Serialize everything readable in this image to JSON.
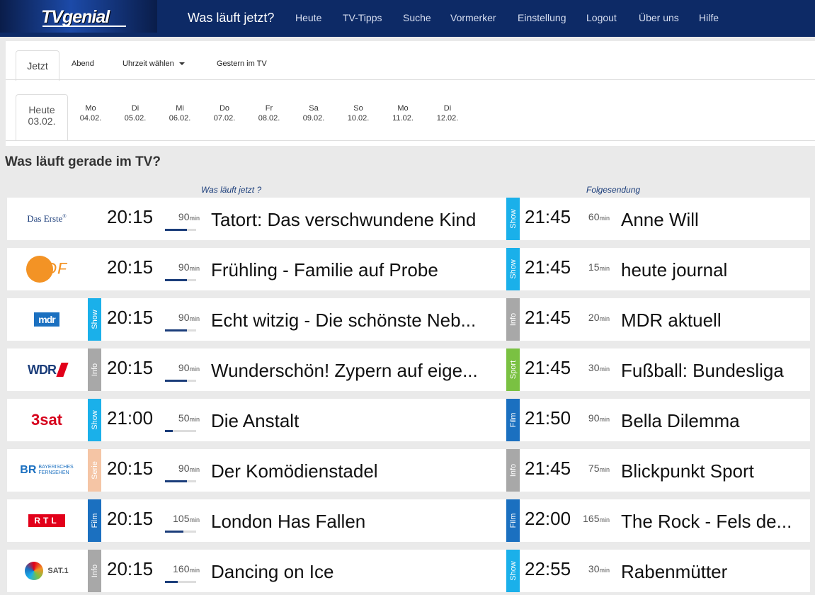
{
  "nav": {
    "logo": "TVgenial",
    "active": "Was läuft jetzt?",
    "items": [
      "Heute",
      "TV-Tipps",
      "Suche",
      "Vormerker",
      "Einstellung",
      "Logout",
      "Über uns",
      "Hilfe"
    ]
  },
  "tabs": {
    "active": "Jetzt",
    "items": [
      "Abend",
      "Uhrzeit wählen",
      "Gestern im TV"
    ]
  },
  "days": {
    "active": {
      "label": "Heute",
      "date": "03.02."
    },
    "items": [
      {
        "day": "Mo",
        "date": "04.02."
      },
      {
        "day": "Di",
        "date": "05.02."
      },
      {
        "day": "Mi",
        "date": "06.02."
      },
      {
        "day": "Do",
        "date": "07.02."
      },
      {
        "day": "Fr",
        "date": "08.02."
      },
      {
        "day": "Sa",
        "date": "09.02."
      },
      {
        "day": "So",
        "date": "10.02."
      },
      {
        "day": "Mo",
        "date": "11.02."
      },
      {
        "day": "Di",
        "date": "12.02."
      }
    ]
  },
  "heading": "Was läuft gerade im TV?",
  "column_now": "Was läuft jetzt ?",
  "column_next": "Folgesendung",
  "unit": "min",
  "genre_colors": {
    "Show": "#1ab0ea",
    "Info": "#a8a8a8",
    "Sport": "#7ac142",
    "Film": "#1b70c0",
    "Serie": "#f5c5a5"
  },
  "rows": [
    {
      "channel": "Das Erste",
      "genre": "",
      "time": "20:15",
      "dur": "90",
      "progress": 0.7,
      "title": "Tatort: Das verschwundene Kind",
      "next_genre": "Show",
      "next_time": "21:45",
      "next_dur": "60",
      "next_title": "Anne Will"
    },
    {
      "channel": "ZDF",
      "genre": "",
      "time": "20:15",
      "dur": "90",
      "progress": 0.7,
      "title": "Frühling - Familie auf Probe",
      "next_genre": "Show",
      "next_time": "21:45",
      "next_dur": "15",
      "next_title": "heute journal"
    },
    {
      "channel": "mdr",
      "genre": "Show",
      "time": "20:15",
      "dur": "90",
      "progress": 0.7,
      "title": "Echt witzig - Die schönste Neb...",
      "next_genre": "Info",
      "next_time": "21:45",
      "next_dur": "20",
      "next_title": "MDR aktuell"
    },
    {
      "channel": "WDR",
      "genre": "Info",
      "time": "20:15",
      "dur": "90",
      "progress": 0.7,
      "title": "Wunderschön! Zypern auf eige...",
      "next_genre": "Sport",
      "next_time": "21:45",
      "next_dur": "30",
      "next_title": "Fußball: Bundesliga"
    },
    {
      "channel": "3sat",
      "genre": "Show",
      "time": "21:00",
      "dur": "50",
      "progress": 0.25,
      "title": "Die Anstalt",
      "next_genre": "Film",
      "next_time": "21:50",
      "next_dur": "90",
      "next_title": "Bella Dilemma"
    },
    {
      "channel": "BR",
      "genre": "Serie",
      "time": "20:15",
      "dur": "90",
      "progress": 0.7,
      "title": "Der Komödienstadel",
      "next_genre": "Info",
      "next_time": "21:45",
      "next_dur": "75",
      "next_title": "Blickpunkt Sport"
    },
    {
      "channel": "RTL",
      "genre": "Film",
      "time": "20:15",
      "dur": "105",
      "progress": 0.6,
      "title": "London Has Fallen",
      "next_genre": "Film",
      "next_time": "22:00",
      "next_dur": "165",
      "next_title": "The Rock - Fels de..."
    },
    {
      "channel": "SAT.1",
      "genre": "Info",
      "time": "20:15",
      "dur": "160",
      "progress": 0.4,
      "title": "Dancing on Ice",
      "next_genre": "Show",
      "next_time": "22:55",
      "next_dur": "30",
      "next_title": "Rabenmütter"
    }
  ],
  "logo_labels": {
    "daserste": "Das Erste",
    "zdf": "ZDF",
    "mdr": "mdr",
    "wdr": "WDR",
    "threesat": "3sat",
    "br_line1": "BAYERISCHES",
    "br_line2": "FERNSEHEN",
    "rtl": "RTL",
    "sat1": "SAT.1"
  }
}
